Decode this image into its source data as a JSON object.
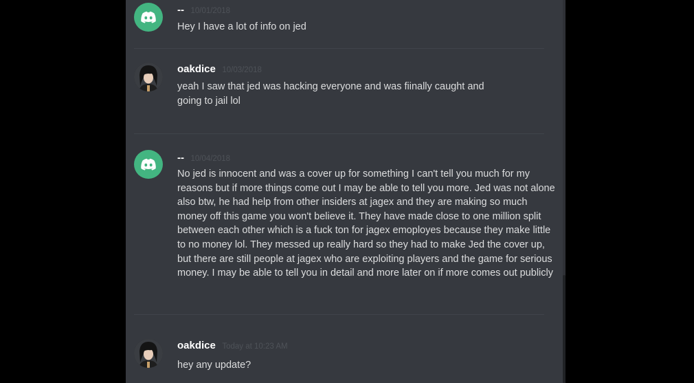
{
  "messages": [
    {
      "username": "--",
      "timestamp": "10/01/2018",
      "text": "Hey I have a lot of info on jed",
      "avatar": "discord-logo-icon"
    },
    {
      "username": "oakdice",
      "timestamp": "10/03/2018",
      "text": "yeah I saw that jed was hacking everyone and was fiinally caught and going to jail lol",
      "avatar": "user-photo"
    },
    {
      "username": "--",
      "timestamp": "10/04/2018",
      "text": "No jed is innocent and was a cover up for something I can't tell you much for my reasons but if more things come out I may be able to tell you more. Jed was not alone also btw, he had help from other insiders at jagex and they are making so much money off this game you won't believe it. They have made close to one million split between each other which is a fuck ton for jagex emoployes because they make little to no money lol. They messed up really hard so they had to make Jed the cover up, but there are still people at jagex who are exploiting players and the game for serious money. I may be able to tell you in detail and more later on if more comes out publicly",
      "avatar": "discord-logo-icon"
    },
    {
      "username": "oakdice",
      "timestamp": "Today at 10:23 AM",
      "text": "hey any update?",
      "avatar": "user-photo"
    }
  ],
  "colors": {
    "background": "#36393f",
    "discord_green": "#43b581",
    "username": "#ffffff",
    "text": "#dcddde",
    "timestamp": "#4e5258"
  }
}
